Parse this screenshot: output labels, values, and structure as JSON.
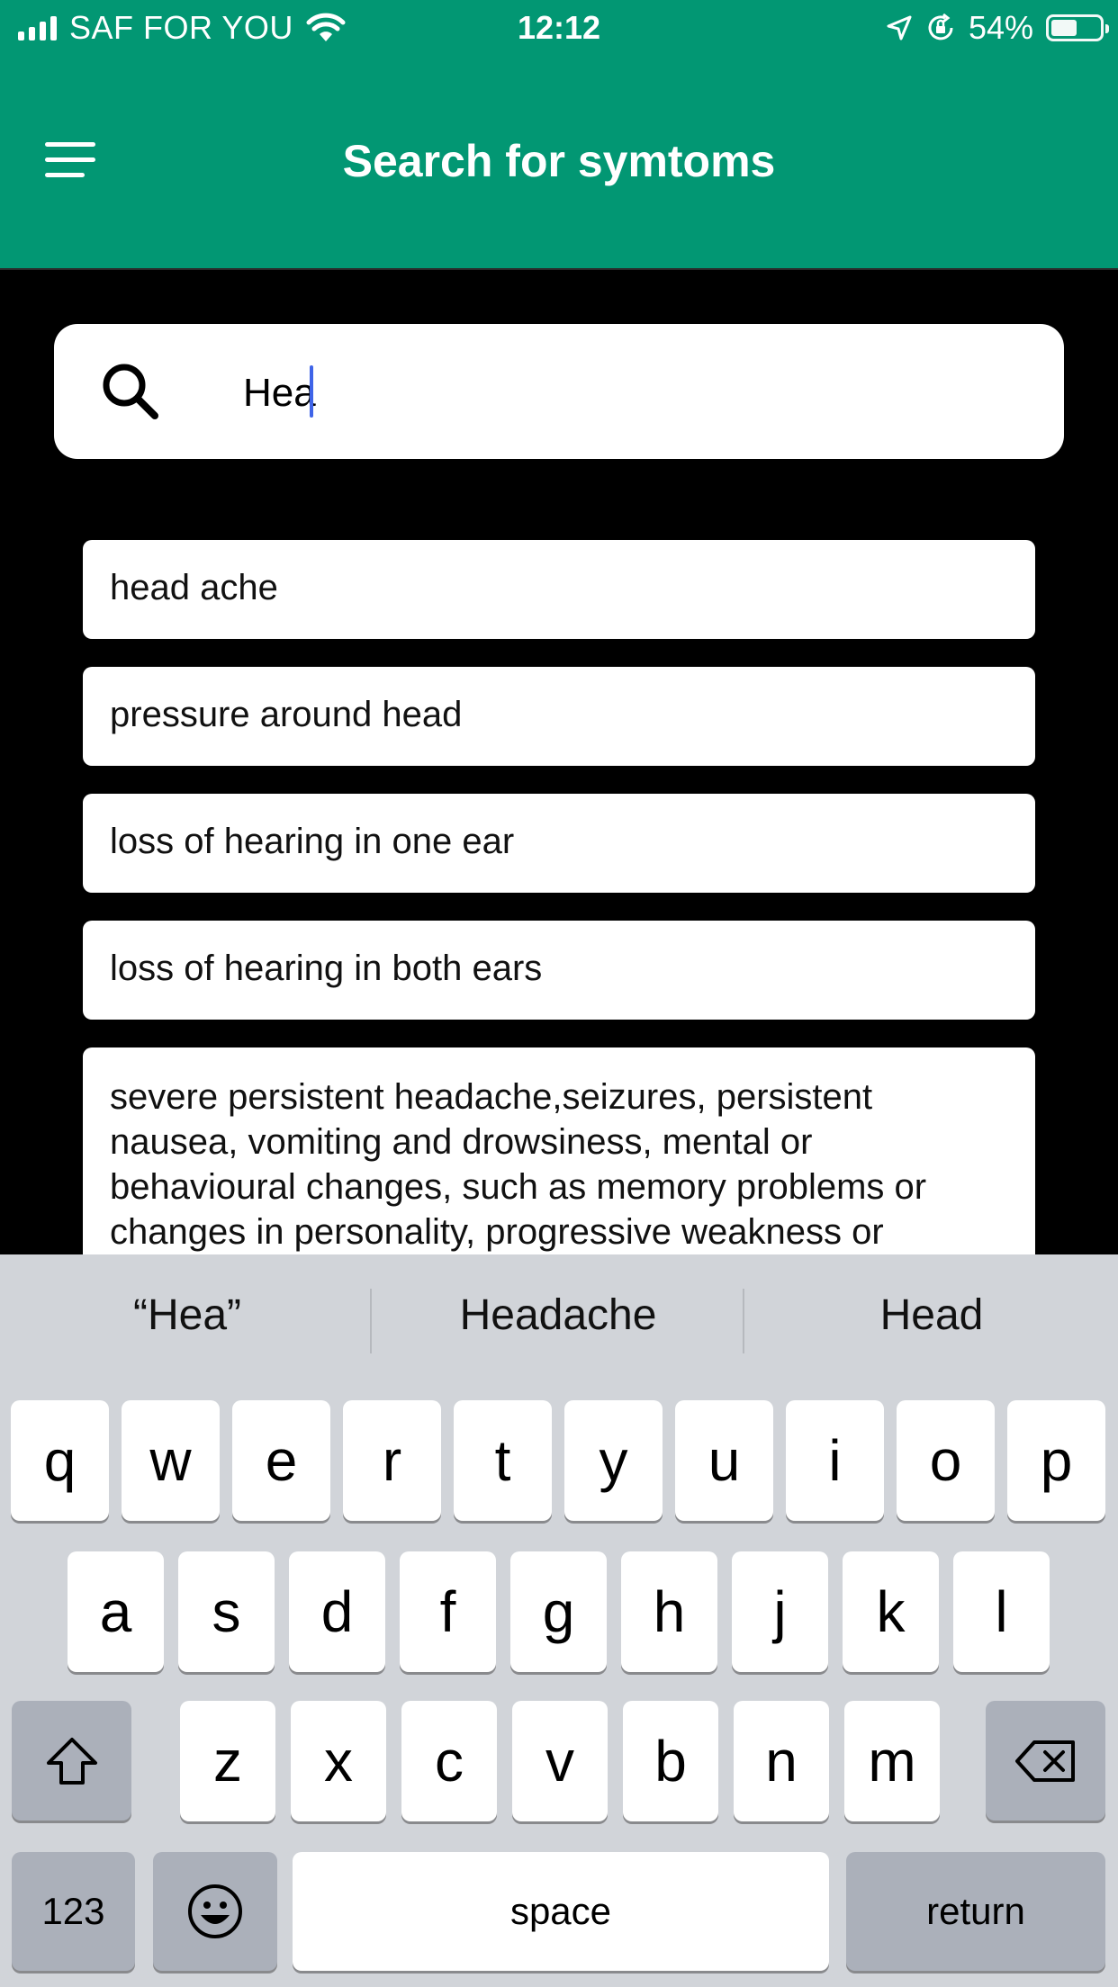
{
  "status": {
    "carrier": "SAF FOR YOU",
    "time": "12:12",
    "battery_label": "54%",
    "battery_level": 0.54
  },
  "header": {
    "title": "Search for symtoms"
  },
  "search": {
    "value": "Hea",
    "placeholder": ""
  },
  "results": [
    "head ache",
    "pressure around head",
    "loss of hearing in one ear",
    "loss of hearing in both ears",
    "severe persistent headache,seizures, persistent nausea, vomiting and drowsiness, mental or behavioural changes, such as memory problems or changes in personality, progressive weakness or"
  ],
  "keyboard": {
    "suggestions": [
      "“Hea”",
      "Headache",
      "Head"
    ],
    "row1": [
      "q",
      "w",
      "e",
      "r",
      "t",
      "y",
      "u",
      "i",
      "o",
      "p"
    ],
    "row2": [
      "a",
      "s",
      "d",
      "f",
      "g",
      "h",
      "j",
      "k",
      "l"
    ],
    "row3": [
      "z",
      "x",
      "c",
      "v",
      "b",
      "n",
      "m"
    ],
    "numbers_label": "123",
    "space_label": "space",
    "return_label": "return"
  },
  "colors": {
    "header": "#029773",
    "caret": "#3f64e8",
    "keyboard": "#d1d4d9"
  }
}
